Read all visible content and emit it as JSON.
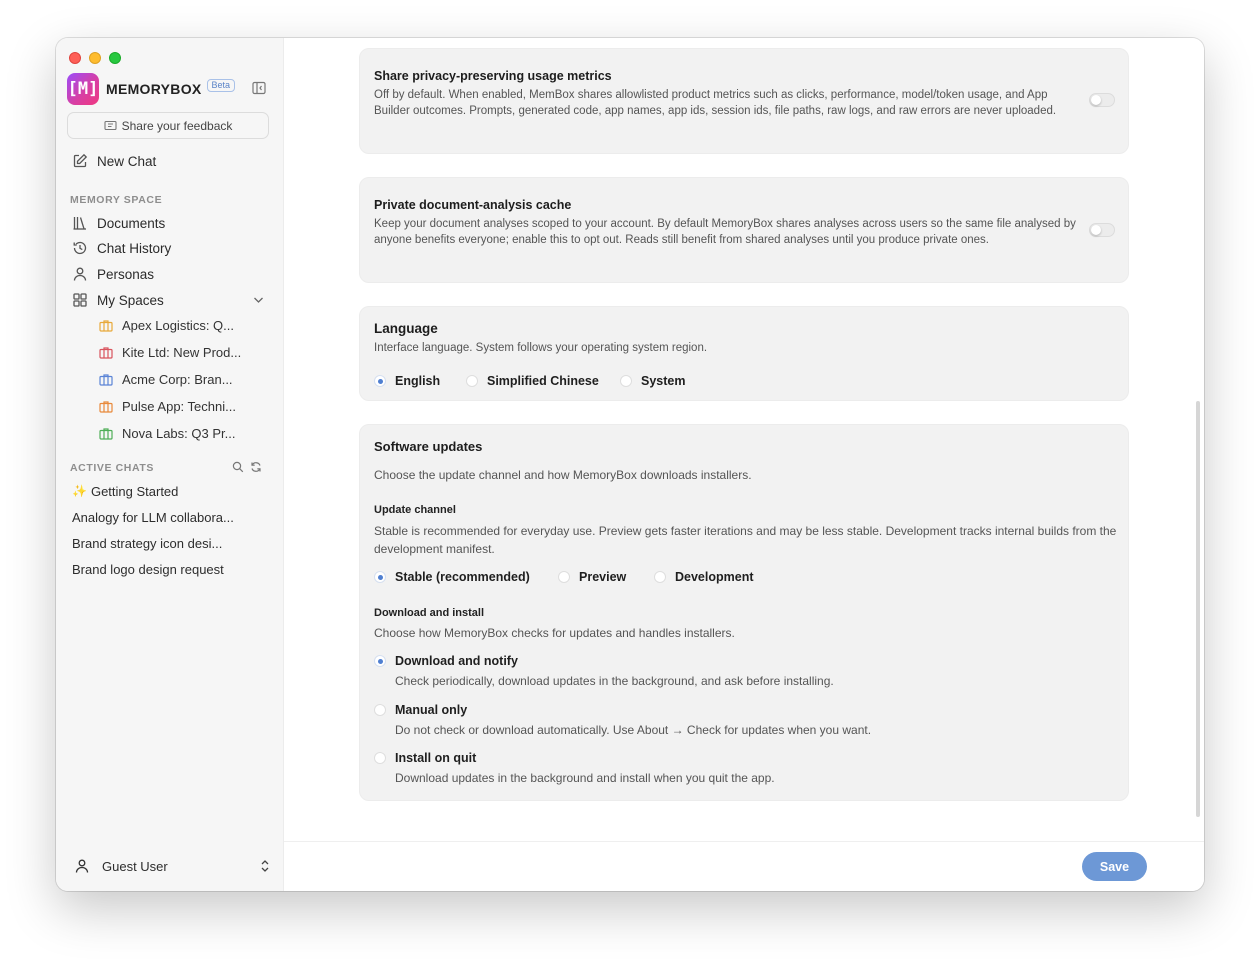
{
  "app": {
    "name": "MEMORYBOX",
    "badge": "Beta",
    "logo_glyph": "[M]"
  },
  "sidebar": {
    "feedback_label": "Share your feedback",
    "new_chat_label": "New Chat",
    "memory_space_heading": "MEMORY SPACE",
    "nav": [
      {
        "label": "Documents",
        "icon": "books-icon"
      },
      {
        "label": "Chat History",
        "icon": "history-icon"
      },
      {
        "label": "Personas",
        "icon": "person-icon"
      },
      {
        "label": "My Spaces",
        "icon": "grid-icon"
      }
    ],
    "spaces": [
      {
        "label": "Apex Logistics: Q...",
        "color": "#e8a93a"
      },
      {
        "label": "Kite Ltd: New Prod...",
        "color": "#d9545e"
      },
      {
        "label": "Acme Corp: Bran...",
        "color": "#5b84d6"
      },
      {
        "label": "Pulse App: Techni...",
        "color": "#e8893a"
      },
      {
        "label": "Nova Labs: Q3 Pr...",
        "color": "#4fae58"
      }
    ],
    "active_chats_heading": "ACTIVE CHATS",
    "chats": [
      {
        "label": "Getting Started",
        "prefix": "✨"
      },
      {
        "label": "Analogy for LLM collabora..."
      },
      {
        "label": "Brand strategy icon desi..."
      },
      {
        "label": "Brand logo design request"
      }
    ],
    "user": {
      "name": "Guest User"
    }
  },
  "settings": {
    "metrics": {
      "title": "Share privacy-preserving usage metrics",
      "desc": "Off by default. When enabled, MemBox shares allowlisted product metrics such as clicks, performance, model/token usage, and App Builder outcomes. Prompts, generated code, app names, app ids, session ids, file paths, raw logs, and raw errors are never uploaded.",
      "enabled": false
    },
    "cache": {
      "title": "Private document-analysis cache",
      "desc": "Keep your document analyses scoped to your account. By default MemoryBox shares analyses across users so the same file analysed by anyone benefits everyone; enable this to opt out. Reads still benefit from shared analyses until you produce private ones.",
      "enabled": false
    },
    "language": {
      "title": "Language",
      "desc": "Interface language. System follows your operating system region.",
      "options": [
        "English",
        "Simplified Chinese",
        "System"
      ],
      "selected": "English"
    },
    "updates": {
      "title": "Software updates",
      "desc": "Choose the update channel and how MemoryBox downloads installers.",
      "channel_title": "Update channel",
      "channel_desc": "Stable is recommended for everyday use. Preview gets faster iterations and may be less stable. Development tracks internal builds from the development manifest.",
      "channel_options": [
        "Stable (recommended)",
        "Preview",
        "Development"
      ],
      "channel_selected": "Stable (recommended)",
      "install_title": "Download and install",
      "install_desc": "Choose how MemoryBox checks for updates and handles installers.",
      "install_options": [
        {
          "label": "Download and notify",
          "desc": "Check periodically, download updates in the background, and ask before installing."
        },
        {
          "label": "Manual only",
          "desc": "Do not check or download automatically. Use About → Check for updates when you want."
        },
        {
          "label": "Install on quit",
          "desc": "Download updates in the background and install when you quit the app."
        }
      ],
      "install_selected": "Download and notify"
    }
  },
  "footer": {
    "save_label": "Save"
  },
  "colors": {
    "accent": "#4f7fd1",
    "save_button": "#6d98d6"
  }
}
